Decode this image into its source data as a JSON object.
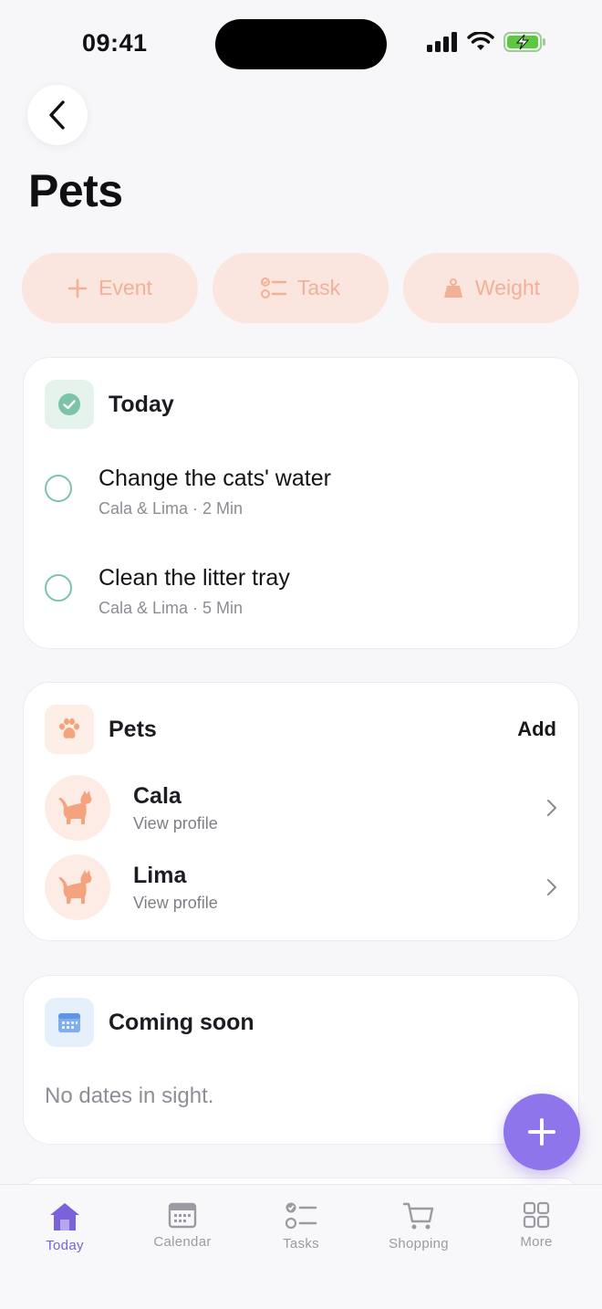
{
  "status_bar": {
    "time": "09:41"
  },
  "page": {
    "title": "Pets"
  },
  "actions": [
    {
      "label": "Event",
      "icon": "plus-icon"
    },
    {
      "label": "Task",
      "icon": "task-list-icon"
    },
    {
      "label": "Weight",
      "icon": "weight-icon"
    }
  ],
  "today": {
    "title": "Today",
    "tasks": [
      {
        "title": "Change the cats' water",
        "meta": "Cala & Lima · 2 Min"
      },
      {
        "title": "Clean the litter tray",
        "meta": "Cala & Lima · 5 Min"
      }
    ]
  },
  "pets": {
    "title": "Pets",
    "add_label": "Add",
    "items": [
      {
        "name": "Cala",
        "sub": "View profile"
      },
      {
        "name": "Lima",
        "sub": "View profile"
      }
    ]
  },
  "coming_soon": {
    "title": "Coming soon",
    "empty": "No dates in sight."
  },
  "tab_bar": {
    "items": [
      {
        "label": "Today",
        "icon": "home-icon",
        "active": true
      },
      {
        "label": "Calendar",
        "icon": "calendar-icon",
        "active": false
      },
      {
        "label": "Tasks",
        "icon": "tasks-icon",
        "active": false
      },
      {
        "label": "Shopping",
        "icon": "cart-icon",
        "active": false
      },
      {
        "label": "More",
        "icon": "grid-icon",
        "active": false
      }
    ]
  },
  "colors": {
    "accent": "#8f75eb",
    "action_bg": "#fbe5df",
    "action_fg": "#f2b197",
    "check_green": "#7cc3a7",
    "pet_orange": "#f5a27f"
  }
}
